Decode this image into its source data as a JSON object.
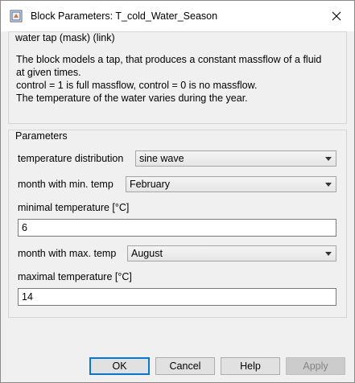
{
  "window": {
    "title": "Block Parameters: T_cold_Water_Season",
    "app_icon": "simulink-block-icon",
    "close_icon": "close-icon"
  },
  "description": {
    "legend": "water tap (mask) (link)",
    "lines": [
      "The block models a tap, that produces a constant massflow of a fluid",
      "at given times.",
      "control = 1 is full massflow, control = 0 is no massflow.",
      "The temperature of the water varies during the year."
    ]
  },
  "parameters": {
    "legend": "Parameters",
    "temperature_distribution": {
      "label": "temperature distribution",
      "value": "sine wave"
    },
    "month_min_temp": {
      "label": "month with min. temp",
      "value": "February"
    },
    "minimal_temperature": {
      "label": "minimal temperature [°C]",
      "value": "6"
    },
    "month_max_temp": {
      "label": "month with max. temp",
      "value": "August"
    },
    "maximal_temperature": {
      "label": "maximal temperature [°C]",
      "value": "14"
    }
  },
  "buttons": {
    "ok": "OK",
    "cancel": "Cancel",
    "help": "Help",
    "apply": "Apply"
  },
  "colors": {
    "background": "#f0f0f0",
    "titlebar": "#ffffff",
    "default_button_border": "#0078d7"
  }
}
